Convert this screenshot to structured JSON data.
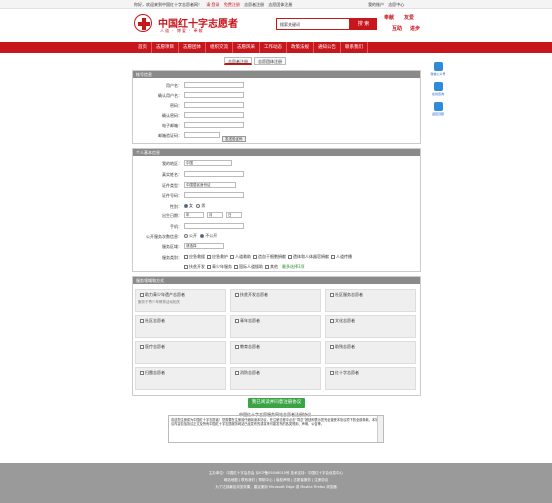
{
  "topbar": {
    "left": [
      "你好，欢迎来到中国红十字志愿者网！",
      "请 登录",
      "免费注册",
      "志愿者注册",
      "志愿团体注册"
    ],
    "right": [
      "我的账户",
      "志愿中心"
    ]
  },
  "header": {
    "site_title": "中国红十字志愿者",
    "site_sub": "人道 · 博爱 · 奉献",
    "search_placeholder": "搜索关键词",
    "search_button": "搜 索",
    "slogan": [
      "奉献",
      "友爱",
      "互助",
      "进步"
    ]
  },
  "nav": {
    "items": [
      "首页",
      "志愿项目",
      "志愿团体",
      "组织交流",
      "志愿风采",
      "工作动态",
      "政策法规",
      "通知公告",
      "联系我们"
    ]
  },
  "tabs": [
    "志愿者注册",
    "志愿团体注册"
  ],
  "account": {
    "header": "帐号信息",
    "fields": [
      "用户名：",
      "确认用户名：",
      "密码：",
      "确认密码：",
      "电子邮箱：",
      "邮箱验证码："
    ],
    "send_code": "发送验证码"
  },
  "personal": {
    "header": "个人基本信息",
    "region_label": "我的地区：",
    "region_value": "中国",
    "name_label": "真实姓名：",
    "idtype_label": "证件类型：",
    "idtype_value": "中国居民身份证",
    "idno_label": "证件号码：",
    "gender_label": "性别：",
    "gender_options": [
      "女",
      "男"
    ],
    "birth_label": "出生日期：",
    "birth_year": "年",
    "birth_month": "月",
    "birth_day": "日",
    "phone_label": "手机：",
    "public_label": "公开服务次数信息：",
    "public_options": [
      "公开",
      "不公开"
    ],
    "edu_label": "服务区域：",
    "edu_value": "请选择",
    "skill_label": "服务类别：",
    "skills": [
      "应急救援",
      "应急救护",
      "人道救助",
      "造血干细胞捐献",
      "遗体和人体器官捐献",
      "人道传播",
      "扶贫开发",
      "青少年服务",
      "国际人道援助",
      "其他"
    ],
    "skill_note": "最多选择3项"
  },
  "service": {
    "header": "服务领域和方式",
    "cards": [
      {
        "title": "助力青少年遗产志愿者",
        "desc": "服务于青少年教育活动相关"
      },
      {
        "title": "扶贫开发志愿者",
        "desc": ""
      },
      {
        "title": "社区服务志愿者",
        "desc": ""
      },
      {
        "title": "社区志愿者",
        "desc": ""
      },
      {
        "title": "青年志愿者",
        "desc": ""
      },
      {
        "title": "文化志愿者",
        "desc": ""
      },
      {
        "title": "医疗志愿者",
        "desc": ""
      },
      {
        "title": "教育志愿者",
        "desc": ""
      },
      {
        "title": "助残志愿者",
        "desc": ""
      },
      {
        "title": "扫雷志愿者",
        "desc": ""
      },
      {
        "title": "消防志愿者",
        "desc": ""
      },
      {
        "title": "红十字志愿者",
        "desc": ""
      }
    ]
  },
  "submit_label": "我已阅读并同意注册协议",
  "terms_title": "中国红十字志愿服务网站志愿者注册协议",
  "terms_text": "欢迎您注册成为中国红十字志愿者！您需要在注册前仔细阅读本协议，在注册过程中点击“同意”按钮即表示您完全接受本协议项下的全部条款。本协议内容包括协议正文及所有中国红十字志愿服务网站已经发布的或将来可能发布的各类规则、声明、公告等。",
  "footer": {
    "lines": [
      "主办单位：中国红十字会总会  京ICP备05048010号  技术支持：中国红十字会信息中心",
      "网站地图 | 联系我们 | 帮助中心 | 版权声明 | 志愿者服务 | 注册协议",
      "为了达到最佳浏览效果，建议使用 Microsoft Edge 或 Mozilla Firefox 浏览器"
    ]
  },
  "side": [
    "微信公众号",
    "在线咨询",
    "返回顶部"
  ]
}
